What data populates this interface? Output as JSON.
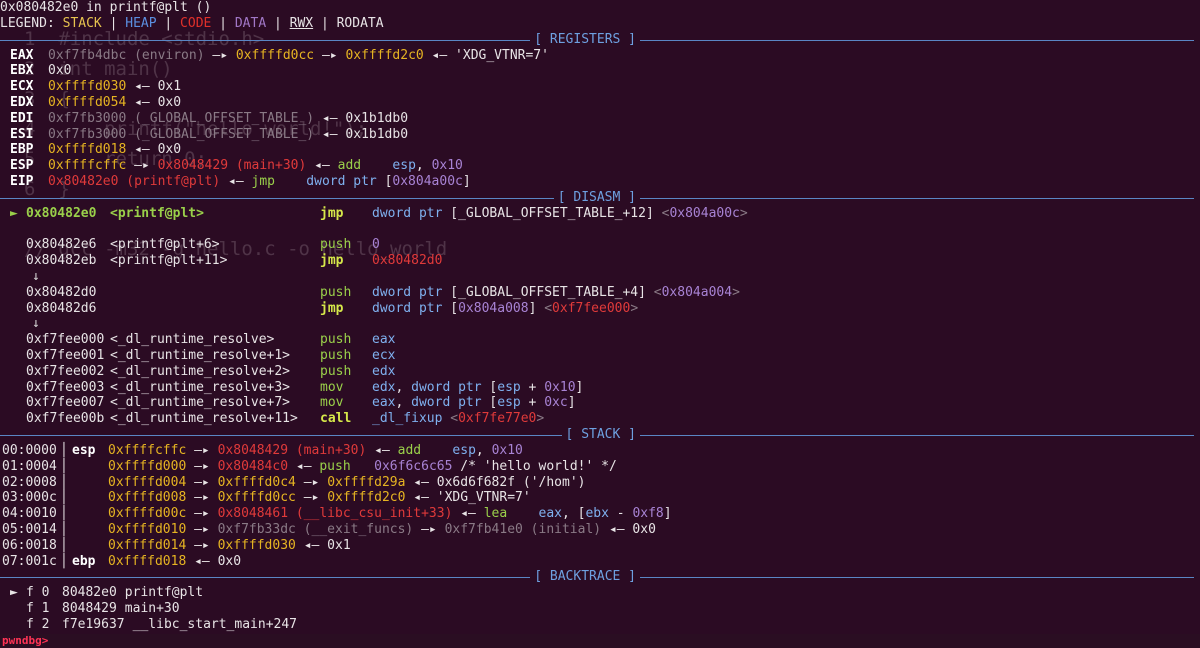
{
  "ghost_lines": [
    "1  #include <stdio.h>",
    "2  int main()",
    "3  {",
    "4      printf(\"hello world!\");",
    "5      return 0;",
    "6  }",
    "",
    "// gcc -m32 -g hello.c -o hello_world"
  ],
  "header": {
    "location": "0x080482e0 in printf@plt ()",
    "legend_prefix": "LEGEND: ",
    "legend_items": [
      {
        "label": "STACK",
        "color": "#e6c34f"
      },
      {
        "label": "HEAP",
        "color": "#5b8fe0"
      },
      {
        "label": "CODE",
        "color": "#e0302a"
      },
      {
        "label": "DATA",
        "color": "#a177c6"
      },
      {
        "label": "RWX",
        "color": "#e8e4e6"
      },
      {
        "label": "RODATA",
        "color": "#e8e4e6"
      }
    ]
  },
  "sections": {
    "registers": "[ REGISTERS ]",
    "disasm": "[ DISASM ]",
    "stack": "[ STACK ]",
    "backtrace": "[ BACKTRACE ]"
  },
  "registers": [
    {
      "name": "EAX",
      "parts": [
        [
          "grey",
          "0xf7fb4dbc (environ)"
        ],
        [
          "wht",
          " —▸ "
        ],
        [
          "yel",
          "0xffffd0cc"
        ],
        [
          "wht",
          " —▸ "
        ],
        [
          "yel",
          "0xffffd2c0"
        ],
        [
          "wht",
          " ◂— 'XDG_VTNR=7'"
        ]
      ]
    },
    {
      "name": "EBX",
      "parts": [
        [
          "wht",
          "0x0"
        ]
      ]
    },
    {
      "name": "ECX",
      "parts": [
        [
          "yel",
          "0xffffd030"
        ],
        [
          "wht",
          " ◂— 0x1"
        ]
      ]
    },
    {
      "name": "EDX",
      "parts": [
        [
          "yel",
          "0xffffd054"
        ],
        [
          "wht",
          " ◂— 0x0"
        ]
      ]
    },
    {
      "name": "EDI",
      "parts": [
        [
          "grey",
          "0xf7fb3000 (_GLOBAL_OFFSET_TABLE_)"
        ],
        [
          "wht",
          " ◂— 0x1b1db0"
        ]
      ]
    },
    {
      "name": "ESI",
      "parts": [
        [
          "grey",
          "0xf7fb3000 (_GLOBAL_OFFSET_TABLE_)"
        ],
        [
          "wht",
          " ◂— 0x1b1db0"
        ]
      ]
    },
    {
      "name": "EBP",
      "parts": [
        [
          "yel",
          "0xffffd018"
        ],
        [
          "wht",
          " ◂— 0x0"
        ]
      ]
    },
    {
      "name": "ESP",
      "parts": [
        [
          "yel",
          "0xffffcffc"
        ],
        [
          "wht",
          " —▸ "
        ],
        [
          "red",
          "0x8048429 (main+30)"
        ],
        [
          "wht",
          " ◂— "
        ],
        [
          "kw-p",
          "add"
        ],
        [
          "wht",
          "    "
        ],
        [
          "blu",
          "esp"
        ],
        [
          "wht",
          ", "
        ],
        [
          "pur",
          "0x10"
        ]
      ]
    },
    {
      "name": "EIP",
      "parts": [
        [
          "red",
          "0x80482e0 (printf@plt)"
        ],
        [
          "wht",
          " ◂— "
        ],
        [
          "kw-p",
          "jmp"
        ],
        [
          "wht",
          "    "
        ],
        [
          "blu",
          "dword ptr "
        ],
        [
          "wht",
          "["
        ],
        [
          "pur",
          "0x804a00c"
        ],
        [
          "wht",
          "]"
        ]
      ]
    }
  ],
  "disasm": [
    {
      "marker": "►",
      "addr": "0x80482e0",
      "sym": "<printf@plt>",
      "op": "jmp",
      "opclass": "kw-j",
      "current": true,
      "args": [
        [
          "blu",
          "dword ptr "
        ],
        [
          "wht",
          "[_GLOBAL_OFFSET_TABLE_+12] "
        ],
        [
          "grey",
          "<"
        ],
        [
          "pur",
          "0x804a00c"
        ],
        [
          "grey",
          ">"
        ]
      ]
    },
    {
      "blank": true
    },
    {
      "marker": "",
      "addr": "0x80482e6",
      "sym": "<printf@plt+6>",
      "op": "push",
      "opclass": "kw-p",
      "args": [
        [
          "pur",
          "0"
        ]
      ]
    },
    {
      "marker": "",
      "addr": "0x80482eb",
      "sym": "<printf@plt+11>",
      "op": "jmp",
      "opclass": "kw-j",
      "args": [
        [
          "red",
          "0x80482d0"
        ]
      ]
    },
    {
      "arrow": "↓"
    },
    {
      "marker": "",
      "addr": "0x80482d0",
      "sym": "",
      "op": "push",
      "opclass": "kw-p",
      "args": [
        [
          "blu",
          "dword ptr "
        ],
        [
          "wht",
          "[_GLOBAL_OFFSET_TABLE_+4] "
        ],
        [
          "grey",
          "<"
        ],
        [
          "pur",
          "0x804a004"
        ],
        [
          "grey",
          ">"
        ]
      ]
    },
    {
      "marker": "",
      "addr": "0x80482d6",
      "sym": "",
      "op": "jmp",
      "opclass": "kw-j",
      "args": [
        [
          "blu",
          "dword ptr "
        ],
        [
          "wht",
          "["
        ],
        [
          "pur",
          "0x804a008"
        ],
        [
          "wht",
          "] "
        ],
        [
          "grey",
          "<"
        ],
        [
          "red",
          "0xf7fee000"
        ],
        [
          "grey",
          ">"
        ]
      ]
    },
    {
      "arrow": "↓"
    },
    {
      "marker": "",
      "addr": "0xf7fee000",
      "sym": "<_dl_runtime_resolve>",
      "op": "push",
      "opclass": "kw-p",
      "args": [
        [
          "blu",
          "eax"
        ]
      ]
    },
    {
      "marker": "",
      "addr": "0xf7fee001",
      "sym": "<_dl_runtime_resolve+1>",
      "op": "push",
      "opclass": "kw-p",
      "args": [
        [
          "blu",
          "ecx"
        ]
      ]
    },
    {
      "marker": "",
      "addr": "0xf7fee002",
      "sym": "<_dl_runtime_resolve+2>",
      "op": "push",
      "opclass": "kw-p",
      "args": [
        [
          "blu",
          "edx"
        ]
      ]
    },
    {
      "marker": "",
      "addr": "0xf7fee003",
      "sym": "<_dl_runtime_resolve+3>",
      "op": "mov",
      "opclass": "kw-p",
      "args": [
        [
          "blu",
          "edx"
        ],
        [
          "wht",
          ", "
        ],
        [
          "blu",
          "dword ptr "
        ],
        [
          "wht",
          "["
        ],
        [
          "blu",
          "esp"
        ],
        [
          "wht",
          " + "
        ],
        [
          "pur",
          "0x10"
        ],
        [
          "wht",
          "]"
        ]
      ]
    },
    {
      "marker": "",
      "addr": "0xf7fee007",
      "sym": "<_dl_runtime_resolve+7>",
      "op": "mov",
      "opclass": "kw-p",
      "args": [
        [
          "blu",
          "eax"
        ],
        [
          "wht",
          ", "
        ],
        [
          "blu",
          "dword ptr "
        ],
        [
          "wht",
          "["
        ],
        [
          "blu",
          "esp"
        ],
        [
          "wht",
          " + "
        ],
        [
          "pur",
          "0xc"
        ],
        [
          "wht",
          "]"
        ]
      ]
    },
    {
      "marker": "",
      "addr": "0xf7fee00b",
      "sym": "<_dl_runtime_resolve+11>",
      "op": "call",
      "opclass": "kw-j",
      "args": [
        [
          "blu",
          "_dl_fixup "
        ],
        [
          "grey",
          "<"
        ],
        [
          "red",
          "0xf7fe77e0"
        ],
        [
          "grey",
          ">"
        ]
      ]
    }
  ],
  "stack": [
    {
      "off": "00:0000",
      "reg": "esp",
      "parts": [
        [
          "yel",
          "0xffffcffc"
        ],
        [
          "wht",
          " —▸ "
        ],
        [
          "red",
          "0x8048429 (main+30)"
        ],
        [
          "wht",
          " ◂— "
        ],
        [
          "kw-p",
          "add"
        ],
        [
          "wht",
          "    "
        ],
        [
          "blu",
          "esp"
        ],
        [
          "wht",
          ", "
        ],
        [
          "pur",
          "0x10"
        ]
      ]
    },
    {
      "off": "01:0004",
      "reg": "",
      "parts": [
        [
          "yel",
          "0xffffd000"
        ],
        [
          "wht",
          " —▸ "
        ],
        [
          "red",
          "0x80484c0"
        ],
        [
          "wht",
          " ◂— "
        ],
        [
          "kw-p",
          "push"
        ],
        [
          "wht",
          "   "
        ],
        [
          "pur",
          "0x6f6c6c65"
        ],
        [
          "wht",
          " /* 'hello world!' */"
        ]
      ]
    },
    {
      "off": "02:0008",
      "reg": "",
      "parts": [
        [
          "yel",
          "0xffffd004"
        ],
        [
          "wht",
          " —▸ "
        ],
        [
          "yel",
          "0xffffd0c4"
        ],
        [
          "wht",
          " —▸ "
        ],
        [
          "yel",
          "0xffffd29a"
        ],
        [
          "wht",
          " ◂— 0x6d6f682f ('/hom')"
        ]
      ]
    },
    {
      "off": "03:000c",
      "reg": "",
      "parts": [
        [
          "yel",
          "0xffffd008"
        ],
        [
          "wht",
          " —▸ "
        ],
        [
          "yel",
          "0xffffd0cc"
        ],
        [
          "wht",
          " —▸ "
        ],
        [
          "yel",
          "0xffffd2c0"
        ],
        [
          "wht",
          " ◂— 'XDG_VTNR=7'"
        ]
      ]
    },
    {
      "off": "04:0010",
      "reg": "",
      "parts": [
        [
          "yel",
          "0xffffd00c"
        ],
        [
          "wht",
          " —▸ "
        ],
        [
          "red",
          "0x8048461 (__libc_csu_init+33)"
        ],
        [
          "wht",
          " ◂— "
        ],
        [
          "kw-p",
          "lea"
        ],
        [
          "wht",
          "    "
        ],
        [
          "blu",
          "eax"
        ],
        [
          "wht",
          ", ["
        ],
        [
          "blu",
          "ebx"
        ],
        [
          "wht",
          " - "
        ],
        [
          "pur",
          "0xf8"
        ],
        [
          "wht",
          "]"
        ]
      ]
    },
    {
      "off": "05:0014",
      "reg": "",
      "parts": [
        [
          "yel",
          "0xffffd010"
        ],
        [
          "wht",
          " —▸ "
        ],
        [
          "grey",
          "0xf7fb33dc (__exit_funcs)"
        ],
        [
          "wht",
          " —▸ "
        ],
        [
          "grey",
          "0xf7fb41e0 (initial)"
        ],
        [
          "wht",
          " ◂— 0x0"
        ]
      ]
    },
    {
      "off": "06:0018",
      "reg": "",
      "parts": [
        [
          "yel",
          "0xffffd014"
        ],
        [
          "wht",
          " —▸ "
        ],
        [
          "yel",
          "0xffffd030"
        ],
        [
          "wht",
          " ◂— 0x1"
        ]
      ]
    },
    {
      "off": "07:001c",
      "reg": "ebp",
      "parts": [
        [
          "yel",
          "0xffffd018"
        ],
        [
          "wht",
          " ◂— 0x0"
        ]
      ]
    }
  ],
  "backtrace": [
    {
      "marker": "►",
      "frame": "f 0",
      "addr": "80482e0",
      "sym": "printf@plt"
    },
    {
      "marker": "",
      "frame": "f 1",
      "addr": "8048429",
      "sym": "main+30"
    },
    {
      "marker": "",
      "frame": "f 2",
      "addr": "f7e19637",
      "sym": "__libc_start_main+247"
    }
  ],
  "prompt": "pwndbg>"
}
